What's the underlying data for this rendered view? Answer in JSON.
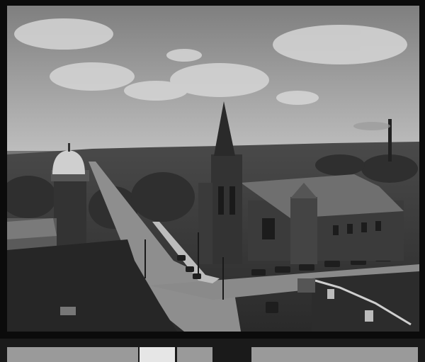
{
  "photo": {
    "kind": "black-and-white aerial cityscape photograph",
    "subjects": [
      "church-with-spire",
      "domed-tower",
      "city-street",
      "parked-cars",
      "smokestack"
    ]
  },
  "colors": {
    "sky_top": "#8a8a8a",
    "sky_bottom": "#b8b8b8",
    "cloud": "#d9d9d9",
    "treeline": "#3a3a3a",
    "street": "#8c8c8c",
    "building_dark": "#2b2b2b",
    "roof_mid": "#6e6e6e",
    "frame": "#0b0b0b"
  }
}
